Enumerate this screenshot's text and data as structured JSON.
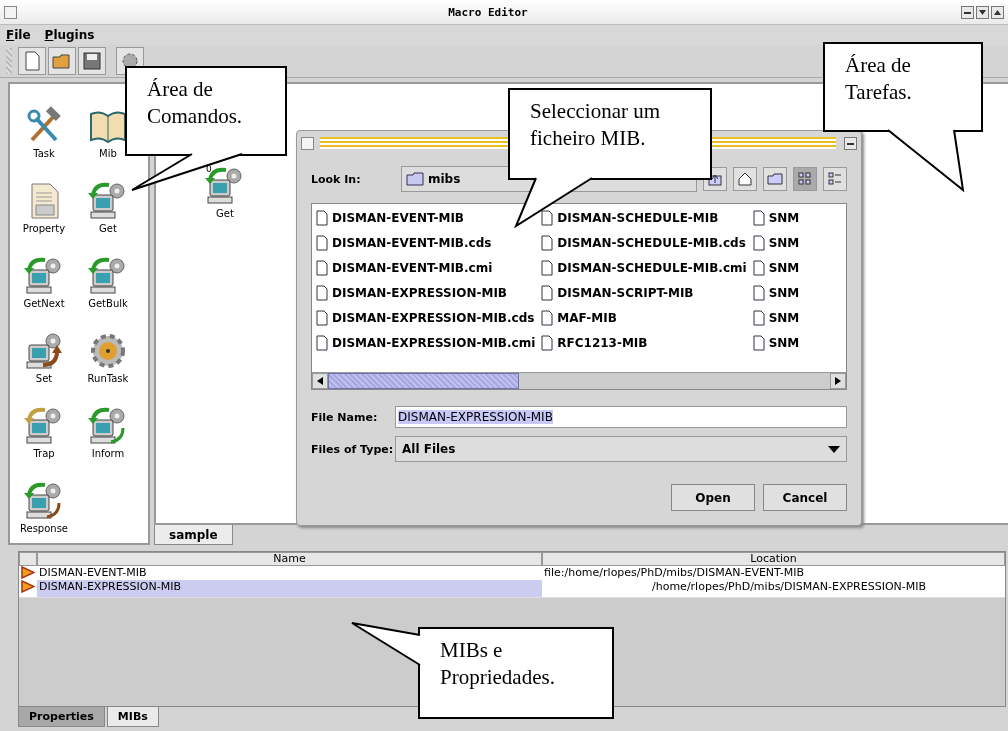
{
  "window": {
    "title": "Macro Editor"
  },
  "menu": [
    {
      "label": "File"
    },
    {
      "label": "Plugins"
    }
  ],
  "toolbar": [
    {
      "kind": "new"
    },
    {
      "kind": "open"
    },
    {
      "kind": "save"
    },
    {
      "kind": "run"
    }
  ],
  "palette": [
    {
      "label": "Task",
      "kind": "tools"
    },
    {
      "label": "Mib",
      "kind": "book"
    },
    {
      "label": "Property",
      "kind": "document"
    },
    {
      "label": "Get",
      "kind": "get"
    },
    {
      "label": "GetNext",
      "kind": "get"
    },
    {
      "label": "GetBulk",
      "kind": "get"
    },
    {
      "label": "Set",
      "kind": "set"
    },
    {
      "label": "RunTask",
      "kind": "gear"
    },
    {
      "label": "Trap",
      "kind": "trap"
    },
    {
      "label": "Inform",
      "kind": "inform"
    },
    {
      "label": "Response",
      "kind": "response"
    }
  ],
  "canvas": {
    "nodes": [
      {
        "label": "Get",
        "badge": "0",
        "kind": "get"
      }
    ],
    "tabs": [
      {
        "label": "sample",
        "selected": true
      }
    ]
  },
  "dialog": {
    "look_in_label": "Look In:",
    "look_in": "mibs",
    "view_buttons": [
      {
        "kind": "list",
        "selected": true
      },
      {
        "kind": "details",
        "selected": false
      }
    ],
    "file_columns": [
      [
        "DISMAN-EVENT-MIB",
        "DISMAN-EVENT-MIB.cds",
        "DISMAN-EVENT-MIB.cmi",
        "DISMAN-EXPRESSION-MIB",
        "DISMAN-EXPRESSION-MIB.cds",
        "DISMAN-EXPRESSION-MIB.cmi"
      ],
      [
        "DISMAN-SCHEDULE-MIB",
        "DISMAN-SCHEDULE-MIB.cds",
        "DISMAN-SCHEDULE-MIB.cmi",
        "DISMAN-SCRIPT-MIB",
        "MAF-MIB",
        "RFC1213-MIB"
      ],
      [
        "SNM",
        "SNM",
        "SNM",
        "SNM",
        "SNM",
        "SNM"
      ]
    ],
    "file_name": {
      "label": "File Name:",
      "value": "DISMAN-EXPRESSION-MIB",
      "highlighted": true
    },
    "file_type": {
      "label": "Files of Type:",
      "value": "All Files"
    },
    "buttons": [
      "Open",
      "Cancel"
    ]
  },
  "table": {
    "columns": [
      "Name",
      "Location"
    ],
    "rows": [
      {
        "name": "DISMAN-EVENT-MIB",
        "location": "file:/home/rlopes/PhD/mibs/DISMAN-EVENT-MIB",
        "selected": false
      },
      {
        "name": "DISMAN-EXPRESSION-MIB",
        "location": "/home/rlopes/PhD/mibs/DISMAN-EXPRESSION-MIB",
        "selected": true
      }
    ]
  },
  "bottom_tabs": [
    {
      "label": "Properties",
      "selected": false
    },
    {
      "label": "MIBs",
      "selected": true
    }
  ],
  "callouts": [
    {
      "text": "Área de Comandos."
    },
    {
      "text": "Seleccionar um ficheiro MIB."
    },
    {
      "text": "Área de Tarefas."
    },
    {
      "text": "MIBs e Propriedades."
    }
  ]
}
